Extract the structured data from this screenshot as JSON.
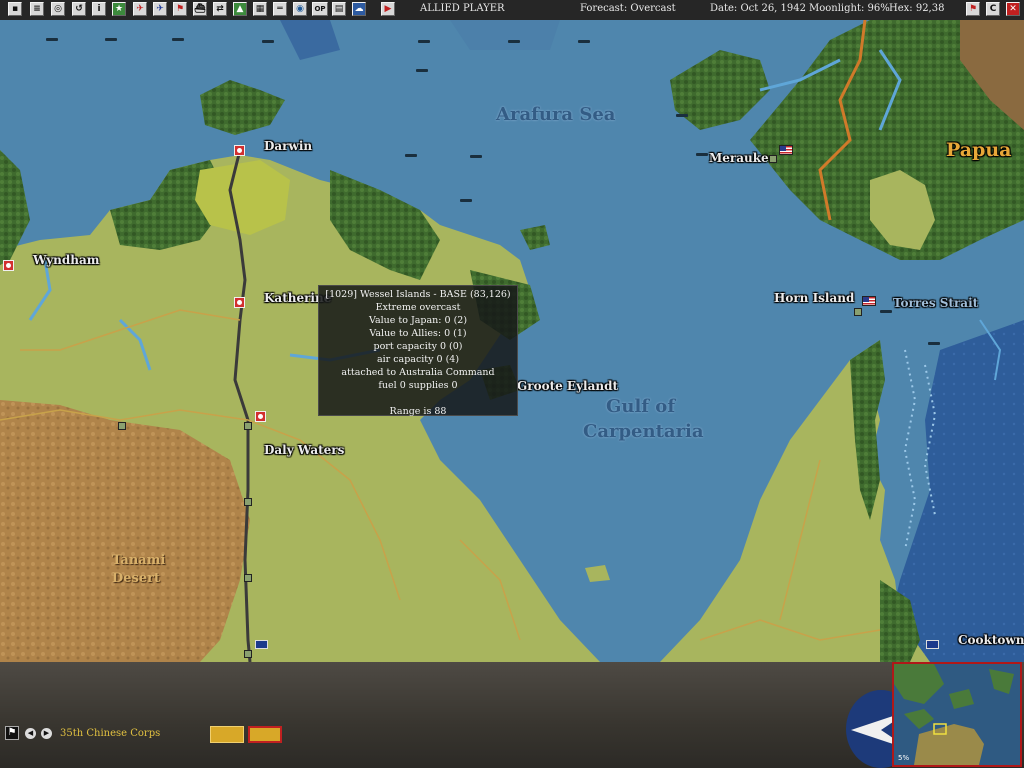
{
  "topbar": {
    "buttons": [
      {
        "name": "save-game-button",
        "glyph": "▪"
      },
      {
        "name": "reports-button",
        "glyph": "≡"
      },
      {
        "name": "intel-button",
        "glyph": "◎"
      },
      {
        "name": "replay-button",
        "glyph": "↺"
      },
      {
        "name": "info-button",
        "glyph": "i"
      },
      {
        "name": "star-button",
        "glyph": "★"
      },
      {
        "name": "air-ops-button",
        "glyph": "✈"
      },
      {
        "name": "naval-air-button",
        "glyph": "✈"
      },
      {
        "name": "flag-button",
        "glyph": "⚑"
      },
      {
        "name": "ships-button",
        "glyph": "⛴"
      },
      {
        "name": "transport-button",
        "glyph": "⇄"
      },
      {
        "name": "ground-button",
        "glyph": "▲"
      },
      {
        "name": "base-button",
        "glyph": "▦"
      },
      {
        "name": "convoy-button",
        "glyph": "═"
      },
      {
        "name": "globe-button",
        "glyph": "◉"
      },
      {
        "name": "sub-button",
        "glyph": "◆"
      },
      {
        "name": "op-button",
        "glyph": "OP"
      },
      {
        "name": "list-button",
        "glyph": "▤"
      },
      {
        "name": "cloud-button",
        "glyph": "☁"
      },
      {
        "name": "end-turn-button",
        "glyph": "▶"
      }
    ],
    "side": "ALLIED PLAYER",
    "forecast": "Forecast: Overcast",
    "date": "Date: Oct 26, 1942",
    "moonlight": "Moonlight: 96%",
    "hex": "Hex: 92,38",
    "right_buttons": [
      {
        "name": "flag-right-button",
        "glyph": "⚑"
      },
      {
        "name": "combat-button",
        "glyph": "C"
      },
      {
        "name": "close-button",
        "glyph": "✕"
      }
    ]
  },
  "map": {
    "seas": [
      {
        "name": "arafura-sea-label",
        "text": "Arafura Sea"
      },
      {
        "name": "gulf-label-line1",
        "text": "Gulf of"
      },
      {
        "name": "gulf-label-line2",
        "text": "Carpentaria"
      },
      {
        "name": "torres-strait-label",
        "text": "Torres Strait"
      }
    ],
    "places": [
      {
        "name": "darwin-label",
        "text": "Darwin"
      },
      {
        "name": "wyndham-label",
        "text": "Wyndham"
      },
      {
        "name": "katherine-label",
        "text": "Katherine"
      },
      {
        "name": "daly-waters-label",
        "text": "Daly Waters"
      },
      {
        "name": "merauke-label",
        "text": "Merauke"
      },
      {
        "name": "horn-island-label",
        "text": "Horn Island"
      },
      {
        "name": "groote-eylandt-label",
        "text": "Groote Eylandt"
      },
      {
        "name": "cooktown-label",
        "text": "Cooktown"
      }
    ],
    "desert_line1": "Tanami",
    "desert_line2": "Desert",
    "papua": "Papua"
  },
  "tooltip": {
    "lines": [
      "[1029] Wessel Islands - BASE (83,126)",
      "Extreme overcast",
      "Value to Japan: 0 (2)",
      "Value to Allies: 0 (1)",
      "port capacity 0 (0)",
      "air capacity 0 (4)",
      "attached to Australia Command",
      "fuel 0 supplies 0",
      "",
      "Range is 88"
    ]
  },
  "bottom": {
    "unit_name": "35th Chinese Corps",
    "minimap_zoom": "5%"
  },
  "colors": {
    "ocean": "#4f86ad",
    "land": "#a8b55e",
    "desert": "#b88a4e",
    "jungle": "#3e6a2c",
    "text_yellow": "#e0c040"
  }
}
